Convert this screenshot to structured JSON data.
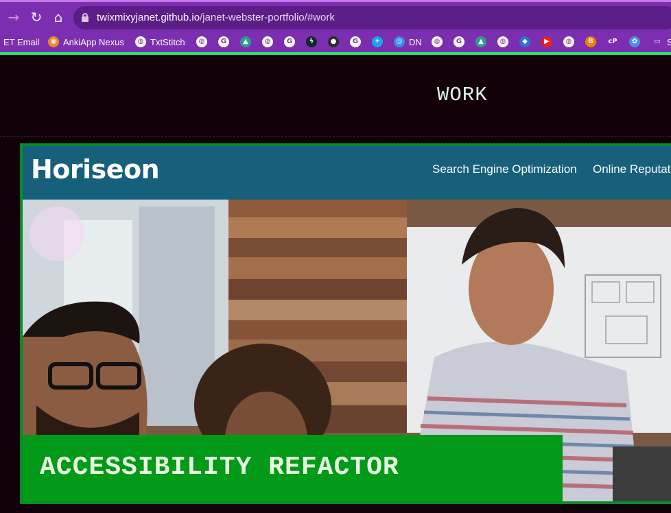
{
  "browser": {
    "url_host": "twixmixyjanet.github.io",
    "url_path": "/janet-webster-portfolio/#work",
    "bookmarks": [
      {
        "label": "ET Email",
        "icon": "none"
      },
      {
        "label": "AnkiApp Nexus",
        "icon": "ankiapp-icon"
      },
      {
        "label": "TxtStitch",
        "icon": "globe-icon"
      },
      {
        "label": "",
        "icon": "globe-icon"
      },
      {
        "label": "",
        "icon": "google-icon"
      },
      {
        "label": "",
        "icon": "drive-icon"
      },
      {
        "label": "",
        "icon": "globe-icon"
      },
      {
        "label": "",
        "icon": "google-icon"
      },
      {
        "label": "",
        "icon": "bolt-icon"
      },
      {
        "label": "",
        "icon": "ghost-icon"
      },
      {
        "label": "",
        "icon": "google-icon"
      },
      {
        "label": "",
        "icon": "twitter-icon"
      },
      {
        "label": "DN",
        "icon": "dn-icon"
      },
      {
        "label": "",
        "icon": "globe-icon"
      },
      {
        "label": "",
        "icon": "google-icon"
      },
      {
        "label": "",
        "icon": "drive-icon"
      },
      {
        "label": "",
        "icon": "globe-icon"
      },
      {
        "label": "",
        "icon": "shield-icon"
      },
      {
        "label": "",
        "icon": "youtube-icon"
      },
      {
        "label": "",
        "icon": "globe-icon"
      },
      {
        "label": "",
        "icon": "blogger-icon"
      },
      {
        "label": "",
        "icon": "cp-icon"
      },
      {
        "label": "",
        "icon": "accessibility-icon"
      },
      {
        "label": "S",
        "icon": "folder-icon"
      }
    ]
  },
  "page": {
    "section_title": "WORK",
    "project": {
      "logo_text": "Horiseon",
      "nav_items": [
        "Search Engine Optimization",
        "Online Reputati"
      ],
      "caption": "ACCESSIBILITY REFACTOR"
    }
  },
  "colors": {
    "chrome_purple": "#7b2fb0",
    "accent_green": "#2ee36d",
    "page_bg": "#120009",
    "caption_green": "#029a18",
    "horiseon_blue": "#17607c"
  }
}
